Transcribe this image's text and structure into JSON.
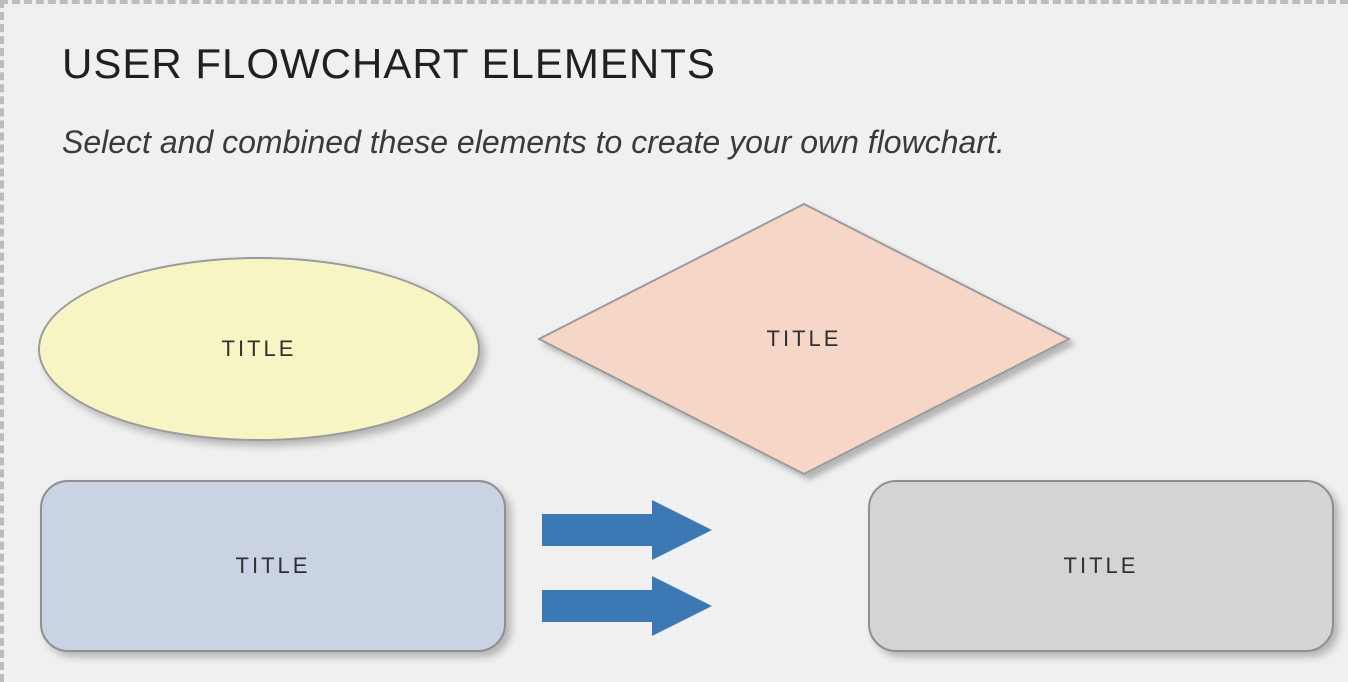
{
  "heading": "USER FLOWCHART ELEMENTS",
  "subheading": "Select and combined these elements to create your own flowchart.",
  "shapes": {
    "ellipse_label": "TITLE",
    "diamond_label": "TITLE",
    "rect_blue_label": "TITLE",
    "rect_grey_label": "TITLE"
  },
  "colors": {
    "ellipse_fill": "#f8f5c5",
    "diamond_fill": "#f6d6c7",
    "rect_blue_fill": "#c9d3e3",
    "rect_grey_fill": "#d4d4d4",
    "arrow_fill": "#3c78b4",
    "border": "#9b9b9b"
  }
}
